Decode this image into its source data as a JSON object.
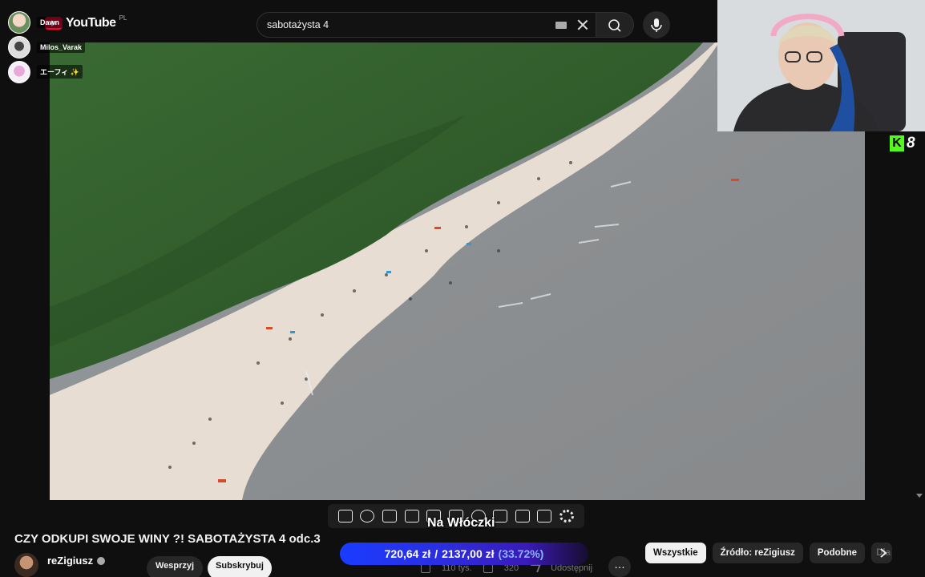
{
  "header": {
    "logo_text": "YouTube",
    "region": "PL",
    "search_value": "sabotażysta 4"
  },
  "chat": [
    {
      "name": "Dawn"
    },
    {
      "name": "Milos_Varak"
    },
    {
      "name": "エーフィ ✨"
    }
  ],
  "kick": {
    "logo": "K",
    "count": "8"
  },
  "player": {
    "overlay_text": "Na Włóczki"
  },
  "video": {
    "title": "CZY ODKUPI SWOJE WINY ?! SABOTAŻYSTA 4 odc.3",
    "channel_name": "reZigiusz",
    "support_label": "Wesprzyj",
    "subscribe_label": "Subskrybuj",
    "likes": "110 tys.",
    "dislikes": "320",
    "share_label": "Udostępnij",
    "more_label": "…"
  },
  "donation": {
    "current": "720,64 zł",
    "separator": "/",
    "goal": "2137,00 zł",
    "percent": "(33.72%)"
  },
  "chips": [
    {
      "label": "Wszystkie",
      "active": true
    },
    {
      "label": "Źródło: reZigiusz",
      "active": false
    },
    {
      "label": "Podobne",
      "active": false
    },
    {
      "label": "Dla",
      "active": false
    }
  ],
  "colors": {
    "brand": "#ff0033",
    "kick": "#53fc18",
    "donation_bar": "#1a3cff"
  }
}
